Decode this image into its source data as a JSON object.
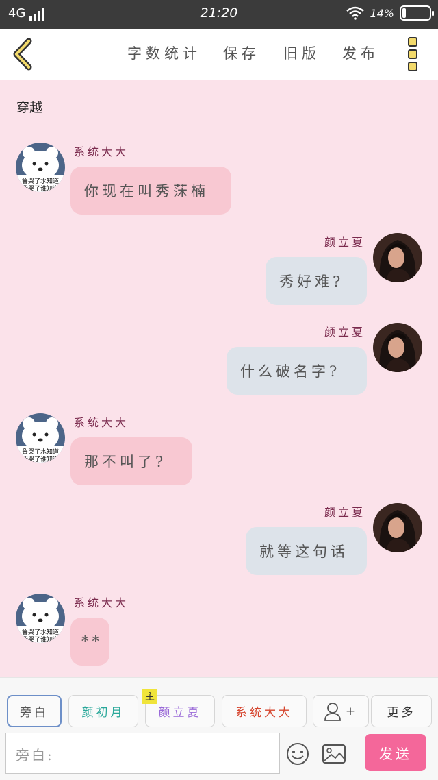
{
  "status_bar": {
    "network": "4G",
    "time": "21:20",
    "battery_text": "14%",
    "battery_level": 0.14
  },
  "nav": {
    "actions": [
      "字数统计",
      "保存",
      "旧版",
      "发布"
    ],
    "back_icon": "chevron-left-icon",
    "menu_icon": "kebab-menu-icon"
  },
  "chapter_title": "穿越",
  "messages": [
    {
      "side": "left",
      "name": "系统大大",
      "text": "你现在叫秀莯楠",
      "avatar_caption": [
        "鲁哭了水知道",
        "我哭了谁知道"
      ]
    },
    {
      "side": "right",
      "name": "颜立夏",
      "text": "秀好难?"
    },
    {
      "side": "right",
      "name": "颜立夏",
      "text": "什么破名字?"
    },
    {
      "side": "left",
      "name": "系统大大",
      "text": "那不叫了?",
      "avatar_caption": [
        "鲁哭了水知道",
        "我哭了谁知道"
      ]
    },
    {
      "side": "right",
      "name": "颜立夏",
      "text": "就等这句话"
    },
    {
      "side": "left",
      "name": "系统大大",
      "text": "**",
      "avatar_caption": [
        "鲁哭了水知道",
        "我哭了谁知道"
      ]
    }
  ],
  "bottom": {
    "roles": [
      "旁白",
      "颜初月",
      "颜立夏",
      "系统大大"
    ],
    "main_tag": "主",
    "add_role_plus": "+",
    "more": "更多",
    "input_placeholder": "旁白:",
    "send": "发送",
    "colors": {
      "narrator": "#555555",
      "yan_chuyue": "#2aa89a",
      "yan_lixia": "#9a6ad8",
      "system": "#d6462f",
      "send_bg": "#f4679a"
    }
  }
}
